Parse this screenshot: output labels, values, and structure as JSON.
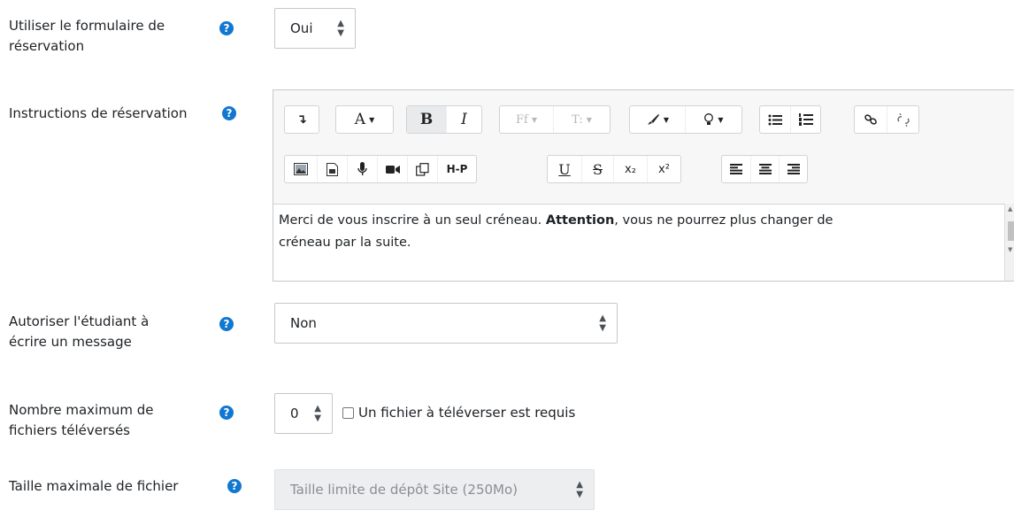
{
  "fields": {
    "booking_form": {
      "label_line1": "Utiliser le formulaire de",
      "label_line2": "réservation",
      "value": "Oui"
    },
    "booking_instructions": {
      "label": "Instructions de réservation",
      "text_before": "Merci de vous inscrire à un seul créneau. ",
      "text_bold": "Attention",
      "text_after": ", vous ne pourrez plus changer de",
      "text_line2": "créneau par la suite."
    },
    "student_message": {
      "label_line1": "Autoriser l'étudiant à",
      "label_line2": "écrire un message",
      "value": "Non"
    },
    "max_files": {
      "label_line1": "Nombre maximum de",
      "label_line2": "fichiers téléversés",
      "value": "0",
      "checkbox_label": "Un fichier à téléverser est requis",
      "checkbox_checked": false
    },
    "max_file_size": {
      "label": "Taille maximale de fichier",
      "value": "Taille limite de dépôt Site (250Mo)"
    }
  },
  "toolbar": {
    "row1": [
      "toggle",
      "font",
      "bold",
      "italic",
      "font-family",
      "font-size",
      "text-color",
      "background-color",
      "unordered-list",
      "ordered-list",
      "link",
      "unlink"
    ],
    "row2": [
      "image",
      "media",
      "record-audio",
      "record-video",
      "manage-files",
      "h5p",
      "underline",
      "strikethrough",
      "subscript",
      "superscript",
      "align-left",
      "align-center",
      "align-right"
    ],
    "labels": {
      "font": "A",
      "bold": "B",
      "italic": "I",
      "font_family": "Ff",
      "font_size": "T:",
      "h5p": "H-P",
      "underline": "U",
      "strike": "S",
      "subscript": "x₂",
      "superscript": "x²"
    }
  },
  "colors": {
    "help_icon": "#1177d1",
    "border": "#c4c8cc",
    "disabled_bg": "#eceeef"
  }
}
